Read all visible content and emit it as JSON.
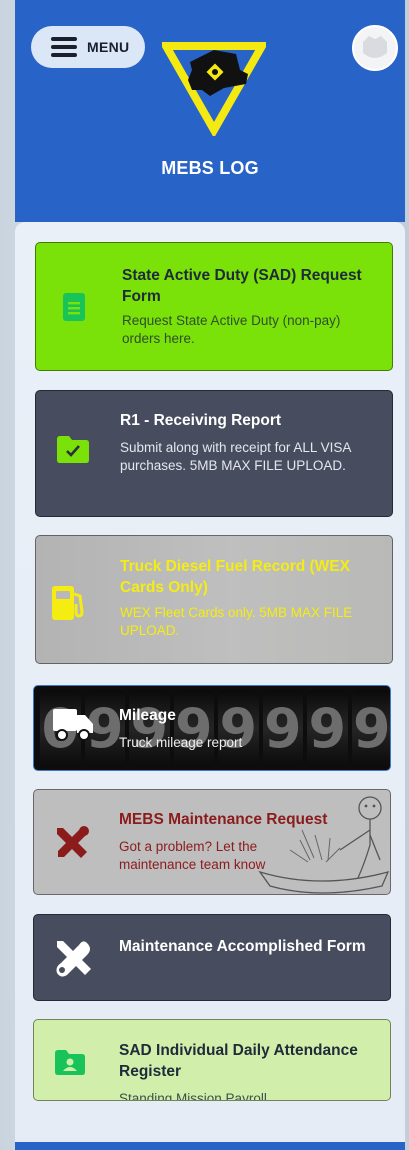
{
  "header": {
    "menu_label": "MENU",
    "app_title": "MEBS LOG"
  },
  "cards": [
    {
      "title": "State Active Duty (SAD) Request Form",
      "description": "Request State Active Duty (non-pay) orders here.",
      "icon": "document-icon"
    },
    {
      "title": "R1 - Receiving Report",
      "description": "Submit along with receipt for ALL VISA purchases. 5MB MAX FILE UPLOAD.",
      "icon": "folder-check-icon"
    },
    {
      "title": "Truck Diesel Fuel Record (WEX Cards Only)",
      "description": "WEX Fleet Cards only. 5MB MAX FILE UPLOAD.",
      "icon": "fuel-pump-icon"
    },
    {
      "title": "Mileage",
      "description": "Truck mileage report",
      "icon": "truck-icon",
      "background_digits": [
        "0",
        "9",
        "9",
        "9",
        "9",
        "9",
        "9",
        "9"
      ]
    },
    {
      "title": "MEBS Maintenance Request",
      "description": "Got a problem? Let the maintenance team know",
      "icon": "tools-crossed-icon"
    },
    {
      "title": "Maintenance Accomplished Form",
      "icon": "wrench-screwdriver-icon"
    },
    {
      "title": "SAD Individual Daily Attendance Register",
      "description": "Standing Mission Payroll",
      "icon": "folder-person-icon"
    }
  ],
  "colors": {
    "header_blue": "#2863c8",
    "sad_green": "#7ae109",
    "slate": "#474d5f",
    "fuel_yellow": "#f5ed11",
    "maintenance_red": "#8c1b1b",
    "attendance_green": "#d1efaa"
  }
}
